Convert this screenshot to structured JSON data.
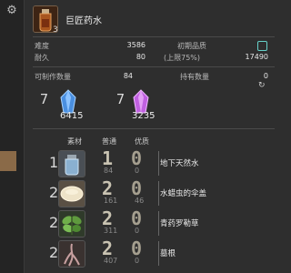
{
  "item": {
    "name": "巨匠药水",
    "qty": "3",
    "icon": "potion-icon"
  },
  "stats": {
    "difficulty_label": "难度",
    "difficulty": "3586",
    "durability_label": "耐久",
    "durability": "80",
    "quality_label": "初期品质",
    "quality_note": "(上限75%)",
    "quality": "17490",
    "craftable_label": "可制作数量",
    "craftable": "84",
    "owned_label": "持有数量",
    "owned": "0"
  },
  "crystals": [
    {
      "name": "water-crystal",
      "required": "7",
      "owned": "6415",
      "color": "#4a8fe0"
    },
    {
      "name": "lightning-crystal",
      "required": "7",
      "owned": "3235",
      "color": "#c060e0"
    }
  ],
  "headers": {
    "material": "素材",
    "normal": "普通",
    "hq": "优质"
  },
  "materials": [
    {
      "name": "地下天然水",
      "count": "1",
      "nq": "1",
      "hq": "0",
      "nq_owned": "84",
      "hq_owned": "0",
      "icon": "water-jar-icon"
    },
    {
      "name": "水蜡虫的伞盖",
      "count": "2",
      "nq": "2",
      "hq": "0",
      "nq_owned": "161",
      "hq_owned": "46",
      "icon": "mushroom-cap-icon"
    },
    {
      "name": "青药罗勒草",
      "count": "2",
      "nq": "2",
      "hq": "0",
      "nq_owned": "311",
      "hq_owned": "0",
      "icon": "herb-icon"
    },
    {
      "name": "墓根",
      "count": "2",
      "nq": "2",
      "hq": "0",
      "nq_owned": "407",
      "hq_owned": "0",
      "icon": "root-icon"
    }
  ]
}
